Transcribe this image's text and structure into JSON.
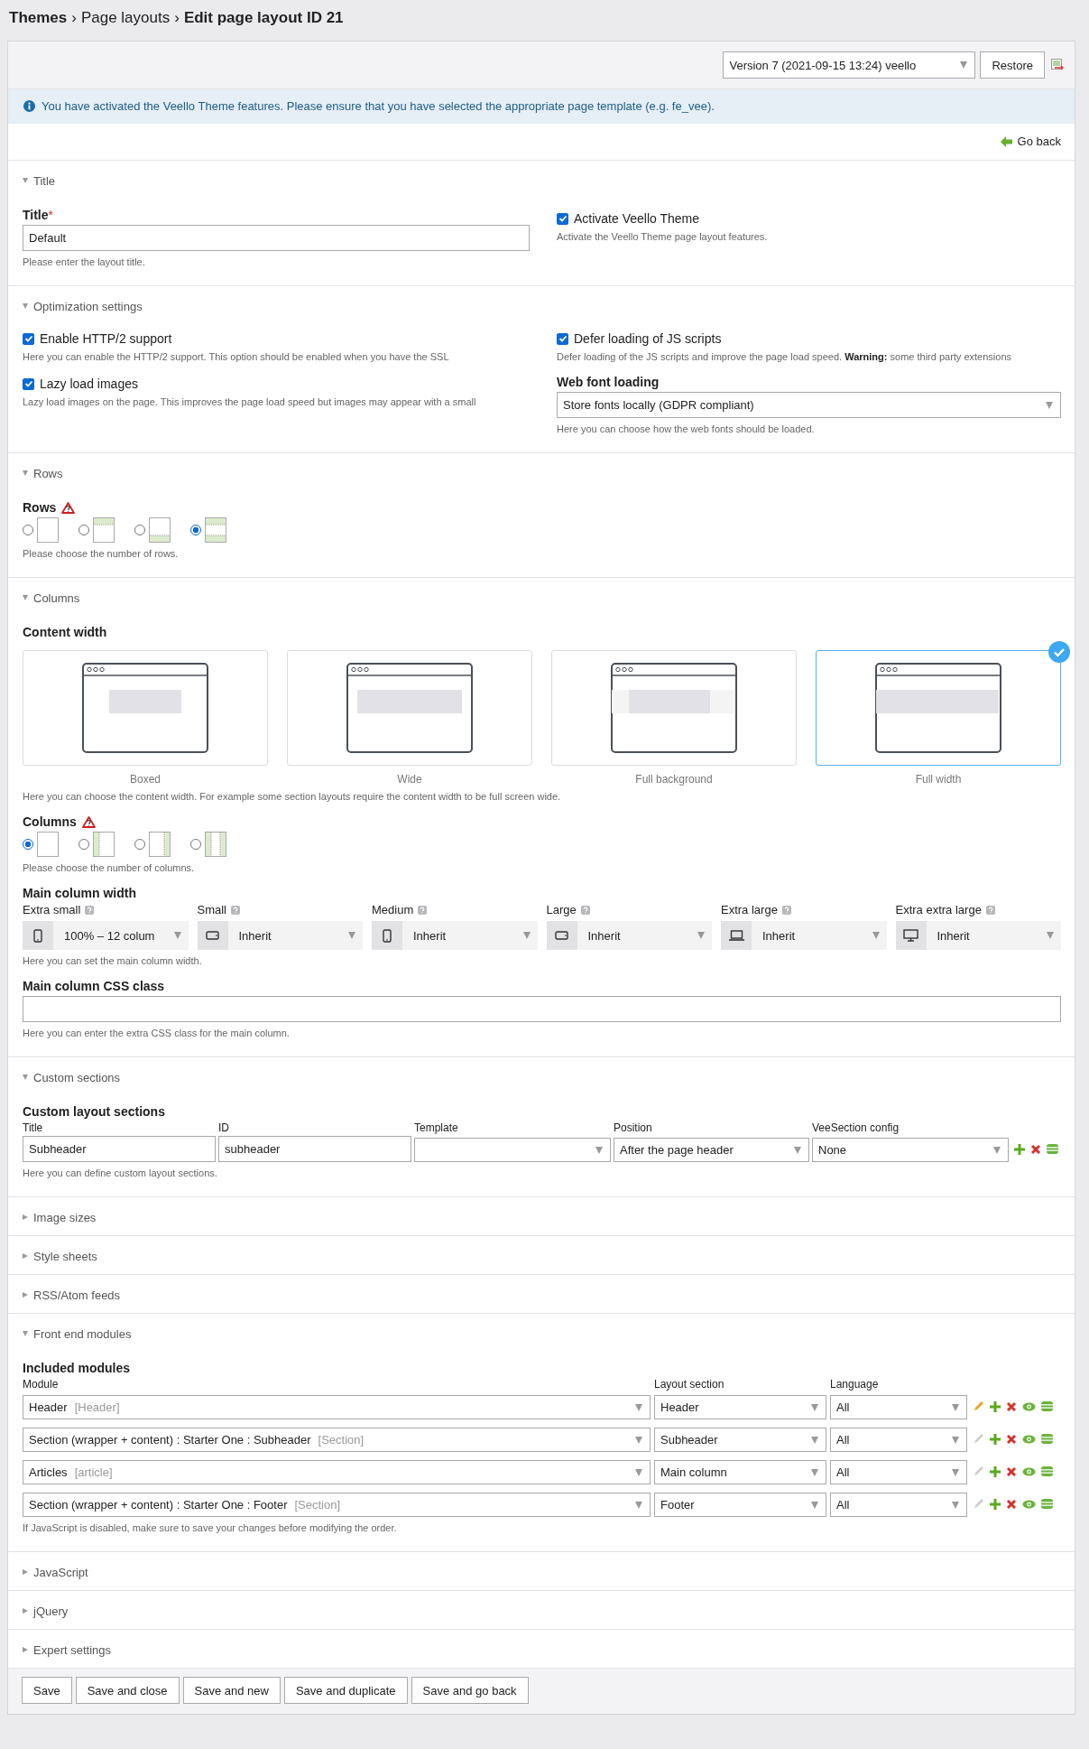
{
  "breadcrumb": {
    "module": "Themes",
    "separator": "›",
    "links": [
      "Page layouts"
    ],
    "current": "Edit page layout ID 21"
  },
  "toolbar": {
    "version": "Version 7 (2021-09-15 13:24) veello",
    "restore": "Restore"
  },
  "info": "You have activated the Veello Theme features. Please ensure that you have selected the appropriate page template (e.g. fe_vee).",
  "go_back": "Go back",
  "sections": [
    {
      "kind": "title",
      "title": "Title",
      "expanded": true,
      "field": {
        "label": "Title",
        "required": "*",
        "value": "Default",
        "help": "Please enter the layout title."
      },
      "checkbox": {
        "label": "Activate Veello Theme",
        "checked": true,
        "help": "Activate the Veello Theme page layout features."
      }
    },
    {
      "kind": "optimization",
      "title": "Optimization settings",
      "expanded": true,
      "left": [
        {
          "label": "Enable HTTP/2 support",
          "checked": true,
          "help": "Here you can enable the HTTP/2 support. This option should be enabled when you have the SSL"
        },
        {
          "label": "Lazy load images",
          "checked": true,
          "help": "Lazy load images on the page. This improves the page load speed but images may appear with a small"
        }
      ],
      "right": {
        "label": "Defer loading of JS scripts",
        "checked": true,
        "help": "Defer loading of the JS scripts and improve the page load speed. **Warning:** some third party extensions"
      },
      "font": {
        "label": "Web font loading",
        "value": "Store fonts locally (GDPR compliant)",
        "help": "Here you can choose how the web fonts should be loaded."
      }
    },
    {
      "kind": "rows",
      "title": "Rows",
      "expanded": true,
      "label": "Rows",
      "options": [
        {
          "kind": "none",
          "selected": false
        },
        {
          "kind": "header",
          "selected": false
        },
        {
          "kind": "footer",
          "selected": false
        },
        {
          "kind": "both",
          "selected": true
        }
      ],
      "help": "Please choose the number of rows."
    },
    {
      "kind": "columns",
      "title": "Columns",
      "expanded": true,
      "content_width": {
        "label": "Content width",
        "cards": [
          {
            "kind": "boxed",
            "label": "Boxed",
            "selected": false
          },
          {
            "kind": "wide",
            "label": "Wide",
            "selected": false
          },
          {
            "kind": "full-background",
            "label": "Full background",
            "selected": false
          },
          {
            "kind": "full-width",
            "label": "Full width",
            "selected": true
          }
        ],
        "help": "Here you can choose the content width. For example some section layouts require the content width to be full screen wide."
      },
      "columns": {
        "label": "Columns",
        "options": [
          {
            "kind": "one",
            "selected": true
          },
          {
            "kind": "left",
            "selected": false
          },
          {
            "kind": "right",
            "selected": false
          },
          {
            "kind": "both",
            "selected": false
          }
        ],
        "help": "Please choose the number of columns."
      },
      "main_width": {
        "label": "Main column width",
        "sizes": [
          {
            "label": "Extra small",
            "kind": "phone",
            "value": "100% – 12 colum"
          },
          {
            "label": "Small",
            "kind": "phone-landscape",
            "value": "Inherit"
          },
          {
            "label": "Medium",
            "kind": "phone",
            "value": "Inherit"
          },
          {
            "label": "Large",
            "kind": "phone-landscape",
            "value": "Inherit"
          },
          {
            "label": "Extra large",
            "kind": "laptop",
            "value": "Inherit"
          },
          {
            "label": "Extra extra large",
            "kind": "desktop",
            "value": "Inherit"
          }
        ],
        "help": "Here you can set the main column width."
      },
      "css_class": {
        "label": "Main column CSS class",
        "help": "Here you can enter the extra CSS class for the main column."
      }
    },
    {
      "kind": "custom",
      "title": "Custom sections",
      "expanded": true,
      "label": "Custom layout sections",
      "columns": [
        "Title",
        "ID",
        "Template",
        "Position",
        "VeeSection config"
      ],
      "rows": [
        {
          "cells": [
            {
              "kind": "input",
              "value": "Subheader"
            },
            {
              "kind": "input",
              "value": "subheader"
            },
            {
              "kind": "select"
            },
            {
              "kind": "select",
              "value": "After the page header"
            },
            {
              "kind": "select",
              "value": "None"
            }
          ]
        }
      ],
      "help": "Here you can define custom layout sections."
    },
    {
      "title": "Image sizes",
      "expanded": false
    },
    {
      "title": "Style sheets",
      "expanded": false
    },
    {
      "title": "RSS/Atom feeds",
      "expanded": false
    },
    {
      "kind": "modules",
      "title": "Front end modules",
      "expanded": true,
      "label": "Included modules",
      "columns": [
        "Module",
        "Layout section",
        "Language"
      ],
      "rows": [
        {
          "module": "Header",
          "type": "[Header]",
          "section": "Header",
          "language": "All",
          "edit_active": true
        },
        {
          "module": "Section (wrapper + content) : Starter One : Subheader",
          "type": "[Section]",
          "section": "Subheader",
          "language": "All",
          "edit_active": false
        },
        {
          "module": "Articles",
          "type": "[article]",
          "section": "Main column",
          "language": "All",
          "edit_active": false
        },
        {
          "module": "Section (wrapper + content) : Starter One : Footer",
          "type": "[Section]",
          "section": "Footer",
          "language": "All",
          "edit_active": false
        }
      ],
      "help": "If JavaScript is disabled, make sure to save your changes before modifying the order."
    },
    {
      "title": "JavaScript",
      "expanded": false
    },
    {
      "title": "jQuery",
      "expanded": false
    },
    {
      "title": "Expert settings",
      "expanded": false
    }
  ],
  "buttons": [
    "Save",
    "Save and close",
    "Save and new",
    "Save and duplicate",
    "Save and go back"
  ]
}
